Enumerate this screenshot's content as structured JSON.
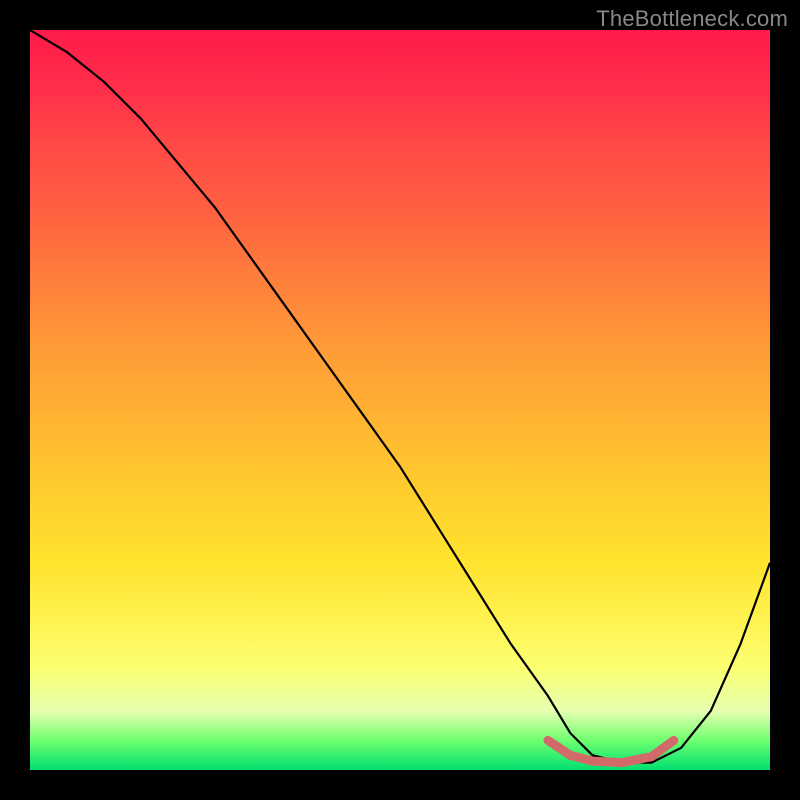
{
  "watermark": "TheBottleneck.com",
  "chart_data": {
    "type": "line",
    "title": "",
    "xlabel": "",
    "ylabel": "",
    "xlim": [
      0,
      100
    ],
    "ylim": [
      0,
      100
    ],
    "series": [
      {
        "name": "bottleneck-curve",
        "x": [
          0,
          5,
          10,
          15,
          20,
          25,
          30,
          35,
          40,
          45,
          50,
          55,
          60,
          65,
          70,
          73,
          76,
          80,
          84,
          88,
          92,
          96,
          100
        ],
        "y": [
          100,
          97,
          93,
          88,
          82,
          76,
          69,
          62,
          55,
          48,
          41,
          33,
          25,
          17,
          10,
          5,
          2,
          1,
          1,
          3,
          8,
          17,
          28
        ]
      },
      {
        "name": "optimal-band",
        "x": [
          70,
          73,
          76,
          80,
          84,
          87
        ],
        "y": [
          4,
          2,
          1.2,
          1,
          1.8,
          4
        ]
      }
    ],
    "colors": {
      "curve": "#000000",
      "optimal": "#d36a6a"
    }
  }
}
